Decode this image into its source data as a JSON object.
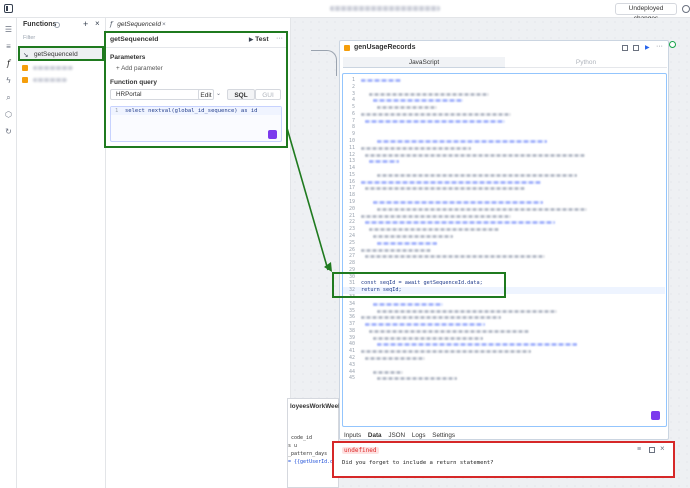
{
  "topbar": {
    "undeployed_label": "Undeployed changes"
  },
  "functions_panel": {
    "title": "Functions",
    "filter_placeholder": "Filter",
    "items": [
      {
        "label": "getSequenceId",
        "selected": true
      }
    ]
  },
  "editor": {
    "tab_label": "getSequenceId",
    "header_title": "getSequenceId",
    "test_label": "Test",
    "parameters_label": "Parameters",
    "add_parameter_label": "Add parameter",
    "function_query_label": "Function query",
    "datasource_value": "HRPortal",
    "edit_label": "Edit",
    "sql_label": "SQL",
    "gui_label": "GUI",
    "query_line_number": "1",
    "query_text": "select nextval(global_id_sequence) as id"
  },
  "widget": {
    "title": "genUsageRecords",
    "tab_js": "JavaScript",
    "tab_py": "Python",
    "line_numbers": [
      "1",
      "2",
      "3",
      "4",
      "5",
      "6",
      "7",
      "8",
      "9",
      "10",
      "11",
      "12",
      "13",
      "14",
      "15",
      "16",
      "17",
      "18",
      "19",
      "20",
      "21",
      "22",
      "23",
      "24",
      "25",
      "26",
      "27",
      "28",
      "29",
      "30",
      "31",
      "32",
      "33",
      "34",
      "35",
      "36",
      "37",
      "38",
      "39",
      "40",
      "41",
      "42",
      "43",
      "44",
      "45"
    ],
    "code_line_31": "const seqId = await getSequenceId.data;",
    "code_line_32": "return seqId;",
    "bottom_tabs": [
      "Inputs",
      "Data",
      "JSON",
      "Logs",
      "Settings"
    ],
    "result_type": "undefined",
    "result_message": "Did you forget to include a return statement?"
  },
  "background_widget": {
    "title_fragment": "loyeesWorkWeek",
    "code_fragments": [
      "code_id",
      "s u",
      "_pattern_days",
      "= {{getUserId.da"
    ]
  },
  "colors": {
    "highlight_green": "#1f7a1f",
    "highlight_red": "#d62828",
    "accent_blue": "#2563eb",
    "keyword_blue": "#1d4ed8",
    "undefined_red": "#dc2626",
    "widget_icon_orange": "#f59e0b"
  }
}
